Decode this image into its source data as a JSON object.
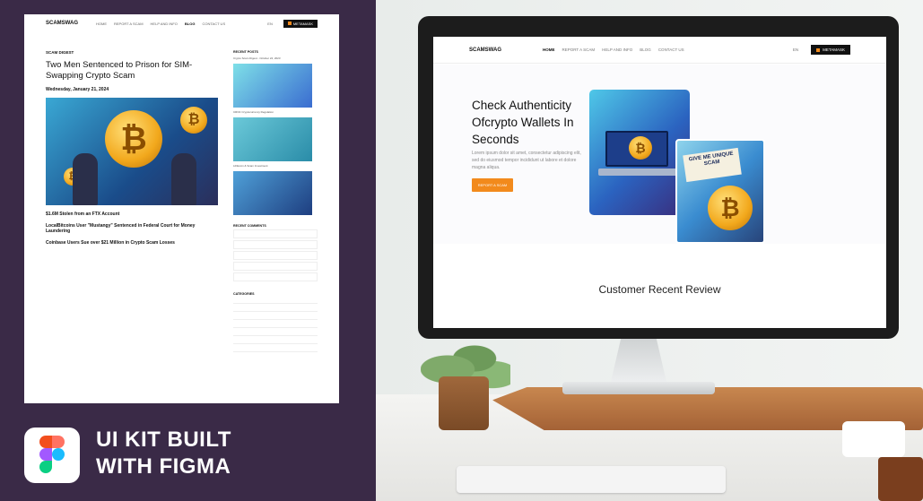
{
  "blog": {
    "logo": "SCAMSWAG",
    "nav": [
      "HOME",
      "REPORT A SCAM",
      "HELP AND INFO",
      "BLOG",
      "CONTACT US"
    ],
    "active_nav_index": 3,
    "lang": "EN",
    "metamask": "METAMASK",
    "kicker": "SCAM DIGEST",
    "title": "Two Men Sentenced to Prison for SIM-Swapping Crypto Scam",
    "date": "Wednesday, January 21, 2024",
    "headline1": "$1.6M Stolen from an FTX Account",
    "headline2": "LocalBitcoins User \"Mustangy\" Sentenced in Federal Court for Money Laundering",
    "headline3": "Coinbase Users Sue over $21 Million in Crypto Scam Losses",
    "sidebar": {
      "recent_posts_title": "RECENT POSTS",
      "recent_post1": "Crypto Scam Digest - October 24, 2023",
      "recent_post2": "CRNC Cryptocurrency Regulation",
      "recent_post3": "LiFEcoin & Scam Investment",
      "recent_comments_title": "RECENT COMMENTS",
      "categories_title": "CATEGORIES"
    }
  },
  "branding": {
    "headline_line1": "UI KIT BUILT",
    "headline_line2": "WITH FIGMA"
  },
  "site": {
    "logo": "SCAMSWAG",
    "nav": [
      "HOME",
      "REPORT A SCAM",
      "HELP AND INFO",
      "BLOG",
      "CONTACT US"
    ],
    "active_nav_index": 0,
    "lang": "EN",
    "metamask": "METAMASK",
    "hero_title": "Check Authenticity Ofcrypto Wallets In Seconds",
    "hero_text": "Lorem ipsum dolor sit amet, consectetur adipiscing elit, sed do eiusmod tempor incididunt ut labore et dolore magna aliqua.",
    "hero_button": "REPORT A SCAM",
    "sign_text": "GIVE ME UNIQUE SCAM",
    "reviews_title": "Customer Recent Review"
  },
  "colors": {
    "accent": "#f28a1c",
    "dark": "#111111",
    "panel": "#3a2a47"
  }
}
